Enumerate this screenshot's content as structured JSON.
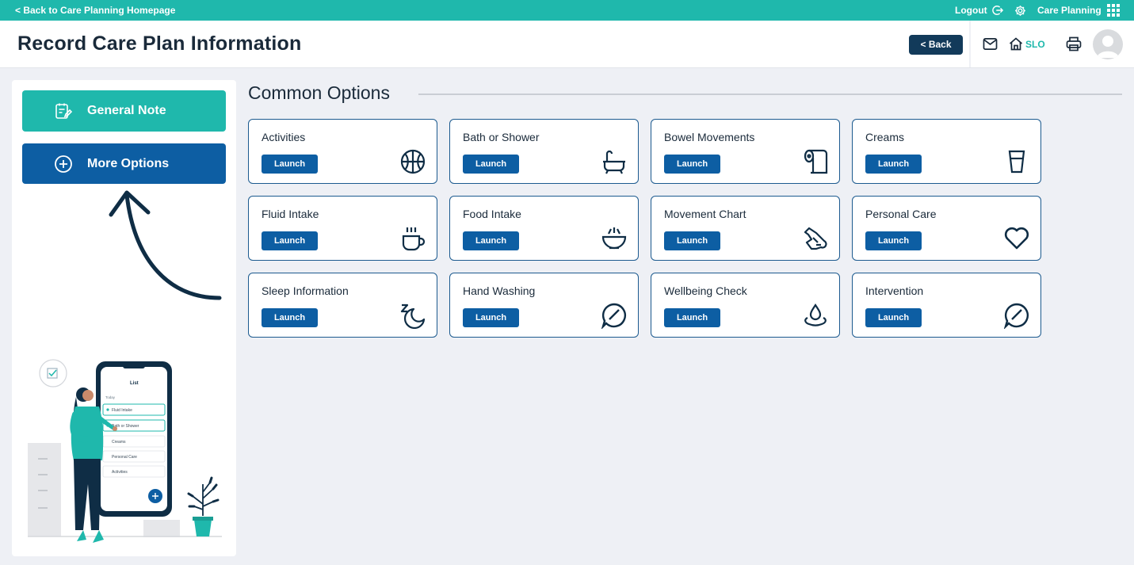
{
  "topbar": {
    "back_link": "< Back to Care Planning Homepage",
    "logout": "Logout",
    "app_name": "Care Planning"
  },
  "header": {
    "title": "Record Care Plan Information",
    "back_button": "< Back",
    "home_label": "SLO"
  },
  "left_panel": {
    "general_note": "General Note",
    "more_options": "More Options"
  },
  "phone_mock": {
    "title": "List",
    "section": "Today",
    "items": [
      "Fluid Intake",
      "Bath or Shower",
      "Creams",
      "Personal Care",
      "Activities"
    ]
  },
  "main": {
    "section_title": "Common Options",
    "launch_label": "Launch",
    "cards": [
      {
        "title": "Activities",
        "icon": "basketball-icon"
      },
      {
        "title": "Bath or Shower",
        "icon": "bathtub-icon"
      },
      {
        "title": "Bowel Movements",
        "icon": "toilet-paper-icon"
      },
      {
        "title": "Creams",
        "icon": "cup-icon"
      },
      {
        "title": "Fluid Intake",
        "icon": "mug-icon"
      },
      {
        "title": "Food Intake",
        "icon": "bowl-icon"
      },
      {
        "title": "Movement Chart",
        "icon": "hand-icon"
      },
      {
        "title": "Personal Care",
        "icon": "heart-icon"
      },
      {
        "title": "Sleep Information",
        "icon": "sleep-moon-icon"
      },
      {
        "title": "Hand Washing",
        "icon": "chat-check-icon"
      },
      {
        "title": "Wellbeing Check",
        "icon": "droplet-ripple-icon"
      },
      {
        "title": "Intervention",
        "icon": "chat-check-icon"
      }
    ]
  },
  "colors": {
    "teal": "#1fb8ac",
    "navy": "#123a5a",
    "blue": "#0d5ea3",
    "background": "#eef0f5"
  }
}
